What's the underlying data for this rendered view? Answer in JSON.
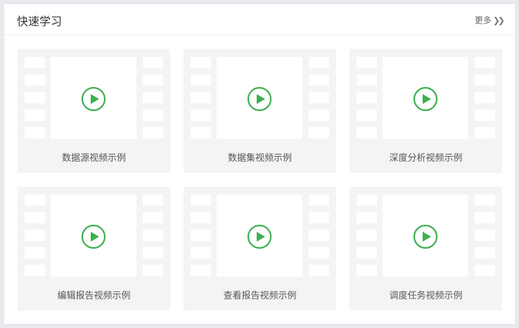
{
  "header": {
    "title": "快速学习",
    "more_label": "更多",
    "more_icon": "double-chevron-right-icon"
  },
  "colors": {
    "accent": "#3cb04f",
    "card_bg": "#f4f4f4",
    "page_bg": "#e9e9ee"
  },
  "videos": [
    {
      "label": "数据源视频示例",
      "icon": "play-icon"
    },
    {
      "label": "数据集视频示例",
      "icon": "play-icon"
    },
    {
      "label": "深度分析视频示例",
      "icon": "play-icon"
    },
    {
      "label": "编辑报告视频示例",
      "icon": "play-icon"
    },
    {
      "label": "查看报告视频示例",
      "icon": "play-icon"
    },
    {
      "label": "调度任务视频示例",
      "icon": "play-icon"
    }
  ]
}
